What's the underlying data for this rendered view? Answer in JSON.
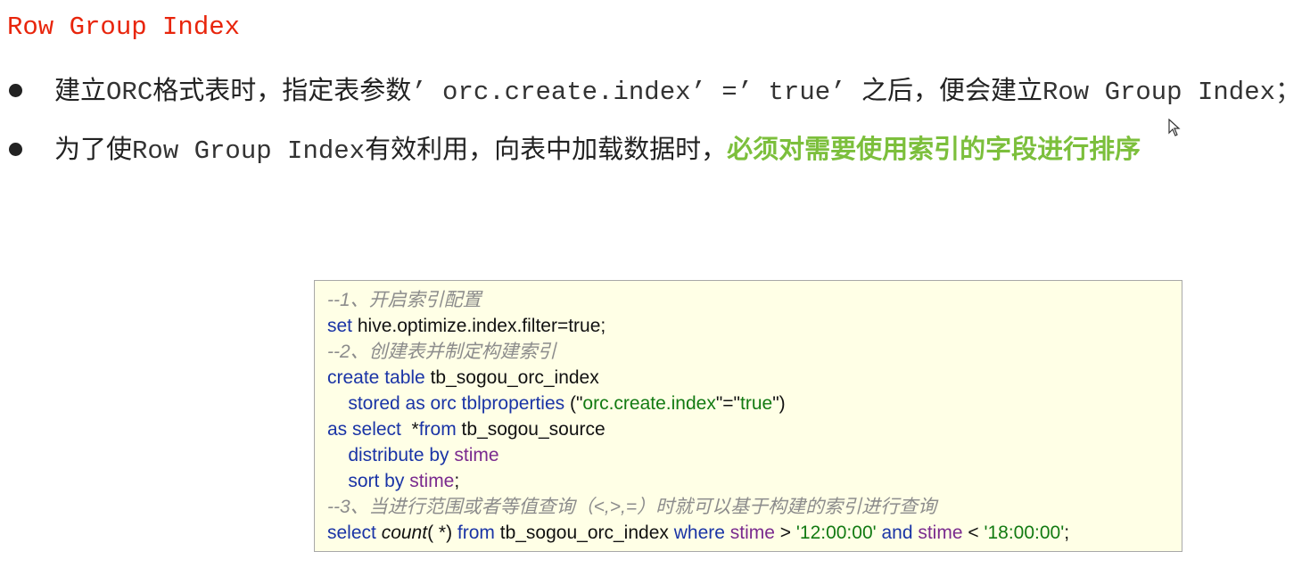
{
  "title": "Row Group Index",
  "bullet1": {
    "p1": "建立",
    "m1": "ORC",
    "p2": "格式表时，指定表参数",
    "m2": "’ orc.create.index’ =’ true’ ",
    "p3": "之后，便会建立",
    "m3": "Row Group Index；"
  },
  "bullet2": {
    "p1": "为了使",
    "m1": "Row Group Index",
    "p2": "有效利用，向表中加载数据时，",
    "highlight": "必须对需要使用索引的字段进行排序"
  },
  "code": {
    "l1": "--1、开启索引配置",
    "l2_kw": "set",
    "l2_rest": " hive.optimize.index.filter=true;",
    "l3": "--2、创建表并制定构建索引",
    "l4_kw": "create table",
    "l4_rest": " tb_sogou_orc_index",
    "l5_kw": "    stored as orc tblproperties",
    "l5_a": " (\"",
    "l5_s1": "orc.create.index",
    "l5_b": "\"=\"",
    "l5_s2": "true",
    "l5_c": "\")",
    "l6_kw1": "as select",
    "l6_a": "  *",
    "l6_kw2": "from",
    "l6_rest": " tb_sogou_source",
    "l7_kw": "    distribute by",
    "l7_col": " stime",
    "l8_kw": "    sort by",
    "l8_col": " stime",
    "l8_end": ";",
    "l9": "--3、当进行范围或者等值查询（<,>,=）时就可以基于构建的索引进行查询",
    "l10_kw1": "select",
    "l10_fn": " count",
    "l10_a": "( *) ",
    "l10_kw2": "from",
    "l10_tbl": " tb_sogou_orc_index ",
    "l10_kw3": "where",
    "l10_col1": " stime",
    "l10_gt": " > ",
    "l10_s1": "'12:00:00'",
    "l10_kw4": " and",
    "l10_col2": " stime",
    "l10_lt": " < ",
    "l10_s2": "'18:00:00'",
    "l10_end": ";"
  },
  "colors": {
    "title": "#e8250c",
    "highlight": "#7cbf3c",
    "keyword": "#1a34a6",
    "string": "#127a12",
    "column": "#7a2a8e",
    "comment": "#8c8c8c",
    "code_bg": "#ffffe6"
  },
  "icons": {
    "cursor": "mouse-pointer-icon"
  }
}
